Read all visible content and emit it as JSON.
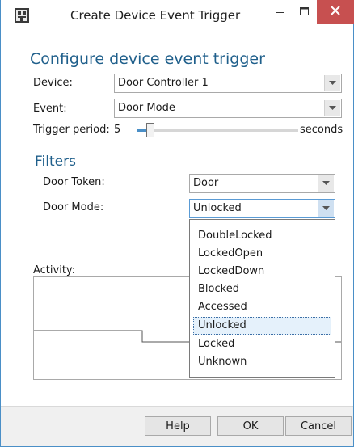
{
  "window": {
    "title": "Create Device Event Trigger",
    "icon": "device-trigger-icon",
    "controls": [
      "minimize-icon",
      "maximize-icon",
      "close-icon"
    ]
  },
  "configure": {
    "heading": "Configure device event trigger",
    "device_label": "Device:",
    "device_value": "Door Controller 1",
    "event_label": "Event:",
    "event_value": "Door Mode",
    "trigger_period_label": "Trigger period:",
    "trigger_period_value": "5",
    "trigger_period_unit": "seconds"
  },
  "filters": {
    "heading": "Filters",
    "door_token_label": "Door Token:",
    "door_token_value": "Door",
    "door_mode_label": "Door Mode:",
    "door_mode_value": "Unlocked",
    "door_mode_options": [
      "DoubleLocked",
      "LockedOpen",
      "LockedDown",
      "Blocked",
      "Accessed",
      "Unlocked",
      "Locked",
      "Unknown"
    ],
    "door_mode_selected_index": 5
  },
  "activity": {
    "label": "Activity:"
  },
  "buttons": {
    "help": "Help",
    "ok": "OK",
    "cancel": "Cancel"
  },
  "colors": {
    "accent": "#1f5f8b",
    "close_button": "#c75050",
    "slider_fill": "#4a8fc7"
  }
}
